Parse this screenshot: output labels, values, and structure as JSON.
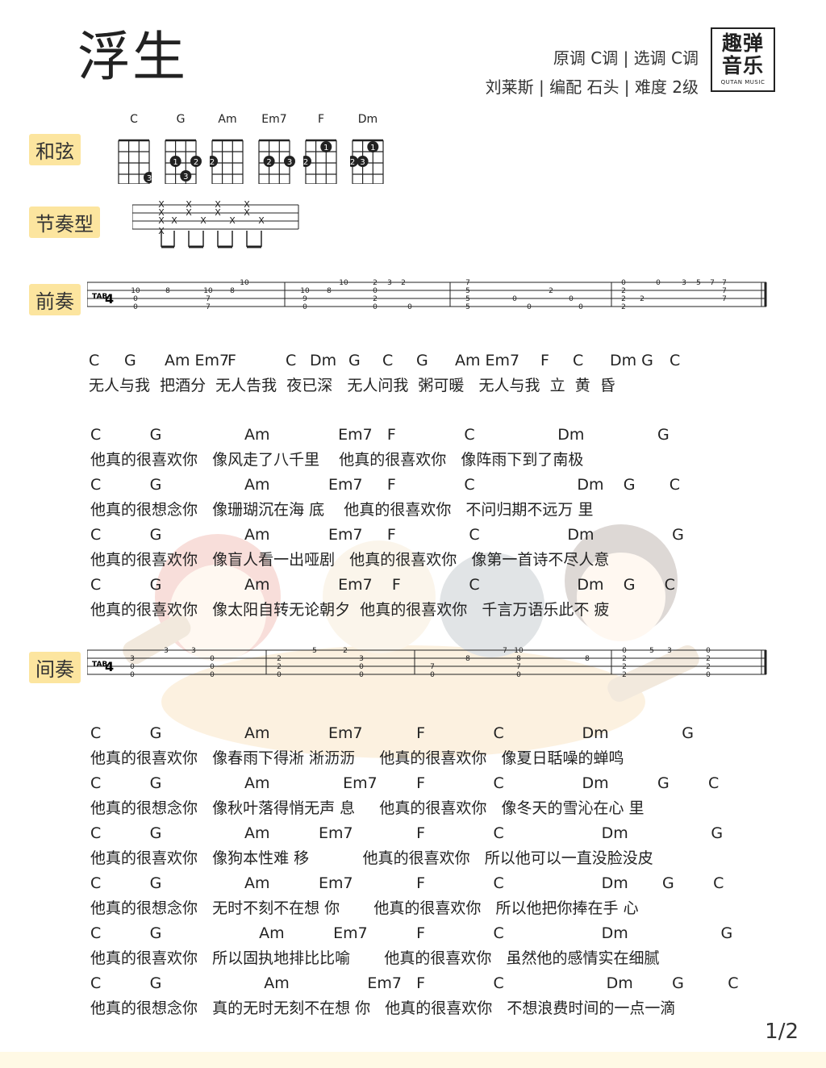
{
  "song": {
    "title": "浮生",
    "meta1": "原调 C调 | 选调 C调",
    "meta2": "刘莱斯 | 编配  石头 | 难度 2级",
    "logo_top": "趣弹",
    "logo_bottom": "音乐",
    "logo_sub": "QUTAN MUSIC"
  },
  "labels": {
    "chords": "和弦",
    "rhythm": "节奏型",
    "intro": "前奏",
    "interlude": "间奏"
  },
  "chord_names": [
    "C",
    "G",
    "Am",
    "Em7",
    "F",
    "Dm"
  ],
  "tab_chords": {
    "intro": [
      "C",
      "G",
      "Am",
      "Em7",
      "F",
      "C",
      "Dm",
      "G",
      "C",
      "G",
      "Am",
      "Em7",
      "F",
      "C",
      "Dm",
      "G",
      "C"
    ],
    "intro_lyric": "无人与我  把酒分  无人告我  夜已深   无人问我  粥可暖   无人与我  立  黄  昏"
  },
  "verses": [
    {
      "chords": "C          G                 Am              Em7   F              C                 Dm               G",
      "lyrics": "他真的很喜欢你   像风走了八千里    他真的很喜欢你   像阵雨下到了南极"
    },
    {
      "chords": "C          G                 Am            Em7     F              C                     Dm    G       C",
      "lyrics": "他真的很想念你   像珊瑚沉在海 底    他真的很喜欢你   不问归期不远万 里"
    },
    {
      "chords": "C          G                 Am            Em7     F               C                  Dm                G",
      "lyrics": "他真的很喜欢你   像盲人看一出哑剧   他真的很喜欢你   像第一首诗不尽人意"
    },
    {
      "chords": "C          G                 Am              Em7    F              C                    Dm    G      C",
      "lyrics": "他真的很喜欢你   像太阳自转无论朝夕  他真的很喜欢你   千言万语乐此不 疲"
    }
  ],
  "verses2": [
    {
      "chords": "C          G                 Am            Em7           F              C                Dm               G",
      "lyrics": "他真的很喜欢你   像春雨下得淅 淅沥沥     他真的很喜欢你   像夏日聒噪的蝉鸣"
    },
    {
      "chords": "C          G                 Am               Em7        F              C                Dm          G        C",
      "lyrics": "他真的很想念你   像秋叶落得悄无声 息     他真的很喜欢你   像冬天的雪沁在心 里"
    },
    {
      "chords": "C          G                 Am          Em7             F              C                    Dm                 G",
      "lyrics": "他真的很喜欢你   像狗本性难 移           他真的很喜欢你   所以他可以一直没脸没皮"
    },
    {
      "chords": "C          G                 Am          Em7             F              C                    Dm       G        C",
      "lyrics": "他真的很想念你   无时不刻不在想 你       他真的很喜欢你   所以他把你捧在手 心"
    },
    {
      "chords": "C          G                    Am          Em7          F              C                    Dm                   G",
      "lyrics": "他真的很喜欢你   所以固执地排比比喻       他真的很喜欢你   虽然他的感情实在细腻"
    },
    {
      "chords": "C          G                     Am                Em7   F              C                     Dm        G         C",
      "lyrics": "他真的很想念你   真的无时无刻不在想 你   他真的很喜欢你   不想浪费时间的一点一滴"
    }
  ],
  "page": "1/2"
}
